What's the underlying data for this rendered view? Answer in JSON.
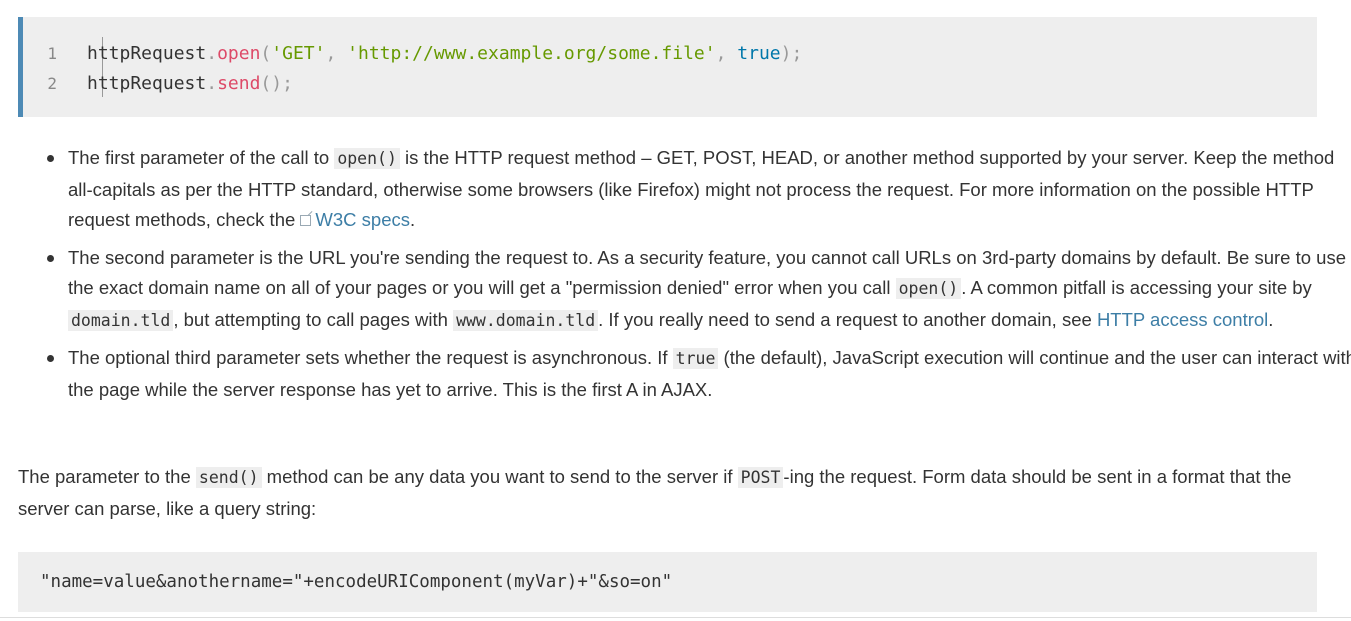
{
  "code_block_1": {
    "lines": [
      {
        "number": "1",
        "obj": "httpRequest",
        "dot": ".",
        "method": "open",
        "open_paren": "(",
        "arg1": "'GET'",
        "comma1": ", ",
        "arg2": "'http://www.example.org/some.file'",
        "comma2": ", ",
        "arg3": "true",
        "close": ");"
      },
      {
        "number": "2",
        "obj": "httpRequest",
        "dot": ".",
        "method": "send",
        "parens": "();"
      }
    ]
  },
  "bullets": [
    {
      "t1": "The first parameter of the call to ",
      "code1": "open()",
      "t2": " is the HTTP request method – GET, POST, HEAD, or another method supported by your server. Keep the method all-capitals as per the HTTP standard, otherwise some browsers (like Firefox) might not process the request. For more information on the possible HTTP request methods, check the ",
      "link_icon": "external-link-icon",
      "link": "W3C specs",
      "t3": "."
    },
    {
      "t1": "The second parameter is the URL you're sending the request to. As a security feature, you cannot call URLs on 3rd-party domains by default. Be sure to use the exact domain name on all of your pages or you will get a \"permission denied\" error when you call ",
      "code1": "open()",
      "t2": ". A common pitfall is accessing your site by ",
      "code2": "domain.tld",
      "t3": ", but attempting to call pages with ",
      "code3": "www.domain.tld",
      "t4": ". If you really need to send a request to another domain, see ",
      "link": "HTTP access control",
      "t5": "."
    },
    {
      "t1": "The optional third parameter sets whether the request is asynchronous. If ",
      "code1": "true",
      "t2": " (the default), JavaScript execution will continue and the user can interact with the page while the server response has yet to arrive. This is the first A in AJAX."
    }
  ],
  "paragraph": {
    "t1": "The parameter to the ",
    "code1": "send()",
    "t2": " method can be any data you want to send to the server if ",
    "code2": "POST",
    "t3": "-ing the request. Form data should be sent in a format that the server can parse, like a query string:"
  },
  "code_block_2": {
    "text": "\"name=value&anothername=\"+encodeURIComponent(myVar)+\"&so=on\""
  },
  "colors": {
    "accent_border": "#4d8ab5",
    "code_bg": "#eeeeee",
    "link": "#3d7ea6",
    "token_function": "#dd4a68",
    "token_string": "#669900",
    "token_boolean": "#0077aa"
  }
}
